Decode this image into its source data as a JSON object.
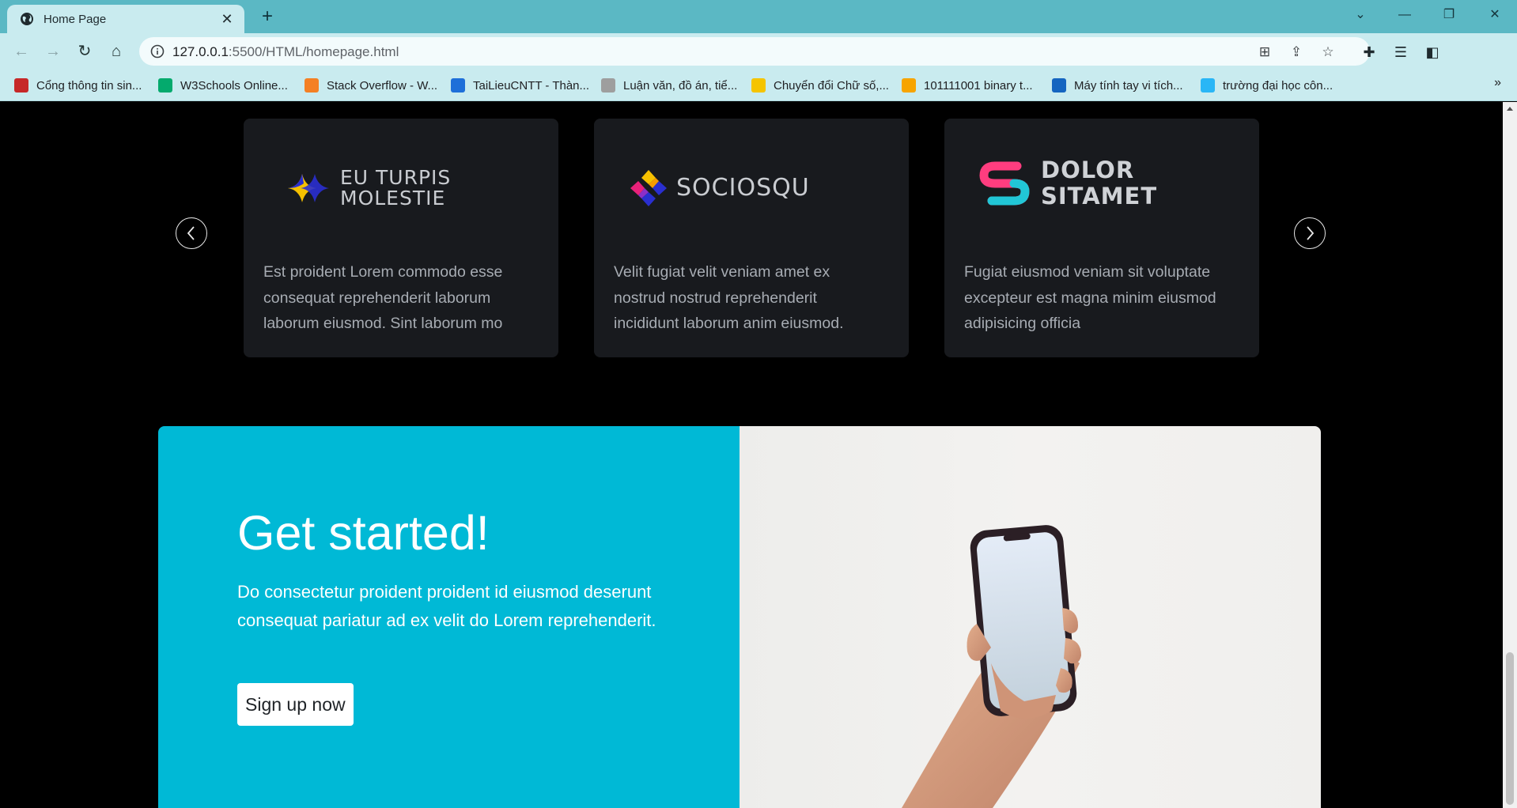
{
  "browser": {
    "tab_title": "Home Page",
    "url_host": "127.0.0.1",
    "url_path": ":5500/HTML/homepage.html",
    "bookmarks": [
      {
        "label": "Cổng thông tin sin...",
        "icon": "vnu-icon",
        "color": "#c62828"
      },
      {
        "label": "W3Schools Online...",
        "icon": "w3schools-icon",
        "color": "#04aa6d"
      },
      {
        "label": "Stack Overflow - W...",
        "icon": "stackoverflow-icon",
        "color": "#f48024"
      },
      {
        "label": "TaiLieuCNTT - Thàn...",
        "icon": "tailieucntt-icon",
        "color": "#1e6fd9"
      },
      {
        "label": "Luận văn, đồ án, tiể...",
        "icon": "document-icon",
        "color": "#9e9e9e"
      },
      {
        "label": "Chuyển đổi Chữ số,...",
        "icon": "converter-icon",
        "color": "#f5c400"
      },
      {
        "label": "101111001 binary t...",
        "icon": "r-icon",
        "color": "#f7a400"
      },
      {
        "label": "Máy tính tay vi tích...",
        "icon": "calculator-icon",
        "color": "#1565c0"
      },
      {
        "label": "trường đại học côn...",
        "icon": "university-icon",
        "color": "#29b6f6"
      }
    ],
    "bookmarks_more": "»"
  },
  "carousel": {
    "cards": [
      {
        "logo_line1": "EU TURPIS",
        "logo_line2": "MOLESTIE",
        "desc": "Est proident Lorem commodo esse consequat reprehenderit laborum laborum eiusmod. Sint laborum mo"
      },
      {
        "logo_line1": "SOCIOSQU",
        "logo_line2": "",
        "desc": "Velit fugiat velit veniam amet ex nostrud nostrud reprehenderit incididunt laborum anim eiusmod."
      },
      {
        "logo_line1": "DOLOR",
        "logo_line2": "SITAMET",
        "desc": "Fugiat eiusmod veniam sit voluptate excepteur est magna minim eiusmod adipisicing officia"
      }
    ]
  },
  "cta": {
    "title": "Get started!",
    "text": "Do consectetur proident proident id eiusmod deserunt consequat pariatur ad ex velit do Lorem reprehenderit.",
    "button": "Sign up now",
    "bg_color": "#00b9d6"
  }
}
